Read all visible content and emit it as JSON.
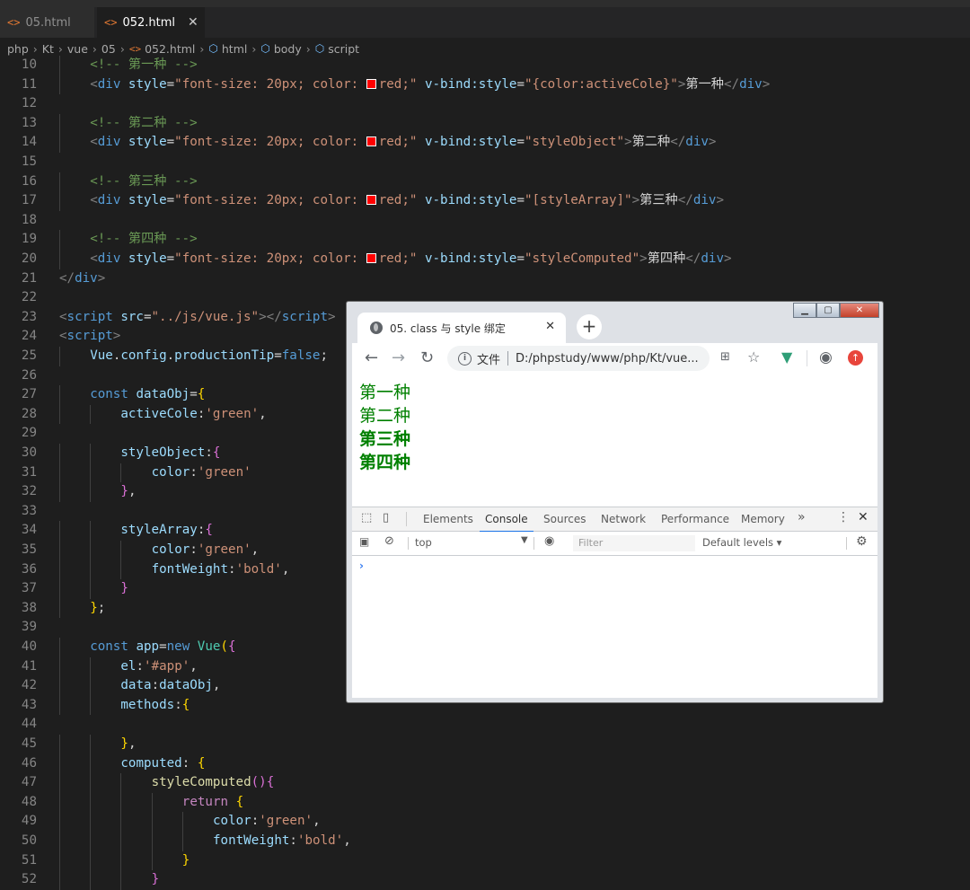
{
  "editor_tabs": [
    {
      "label": "05.html",
      "active": false
    },
    {
      "label": "052.html",
      "active": true
    }
  ],
  "breadcrumb": [
    "php",
    "Kt",
    "vue",
    "05",
    "052.html",
    "html",
    "body",
    "script"
  ],
  "code_lines": [
    {
      "n": "10",
      "indent": 1,
      "parts": [
        {
          "t": "<!-- 第一种 -->",
          "c": "cm"
        }
      ]
    },
    {
      "n": "11",
      "indent": 1,
      "parts": [
        {
          "t": "<",
          "c": "br"
        },
        {
          "t": "div",
          "c": "tag"
        },
        {
          "t": " style",
          "c": "at"
        },
        {
          "t": "=",
          "c": "tx"
        },
        {
          "t": "\"font-size: 20px; color: ",
          "c": "st"
        },
        {
          "t": "",
          "c": "swatch"
        },
        {
          "t": "red;\"",
          "c": "st"
        },
        {
          "t": " v-bind:style",
          "c": "at"
        },
        {
          "t": "=",
          "c": "tx"
        },
        {
          "t": "\"{color:activeCole}\"",
          "c": "st"
        },
        {
          "t": ">",
          "c": "br"
        },
        {
          "t": "第一种",
          "c": "tx"
        },
        {
          "t": "</",
          "c": "br"
        },
        {
          "t": "div",
          "c": "tag"
        },
        {
          "t": ">",
          "c": "br"
        }
      ]
    },
    {
      "n": "12",
      "indent": 0,
      "parts": []
    },
    {
      "n": "13",
      "indent": 1,
      "parts": [
        {
          "t": "<!-- 第二种 -->",
          "c": "cm"
        }
      ]
    },
    {
      "n": "14",
      "indent": 1,
      "parts": [
        {
          "t": "<",
          "c": "br"
        },
        {
          "t": "div",
          "c": "tag"
        },
        {
          "t": " style",
          "c": "at"
        },
        {
          "t": "=",
          "c": "tx"
        },
        {
          "t": "\"font-size: 20px; color: ",
          "c": "st"
        },
        {
          "t": "",
          "c": "swatch"
        },
        {
          "t": "red;\"",
          "c": "st"
        },
        {
          "t": " v-bind:style",
          "c": "at"
        },
        {
          "t": "=",
          "c": "tx"
        },
        {
          "t": "\"styleObject\"",
          "c": "st"
        },
        {
          "t": ">",
          "c": "br"
        },
        {
          "t": "第二种",
          "c": "tx"
        },
        {
          "t": "</",
          "c": "br"
        },
        {
          "t": "div",
          "c": "tag"
        },
        {
          "t": ">",
          "c": "br"
        }
      ]
    },
    {
      "n": "15",
      "indent": 0,
      "parts": []
    },
    {
      "n": "16",
      "indent": 1,
      "parts": [
        {
          "t": "<!-- 第三种 -->",
          "c": "cm"
        }
      ]
    },
    {
      "n": "17",
      "indent": 1,
      "parts": [
        {
          "t": "<",
          "c": "br"
        },
        {
          "t": "div",
          "c": "tag"
        },
        {
          "t": " style",
          "c": "at"
        },
        {
          "t": "=",
          "c": "tx"
        },
        {
          "t": "\"font-size: 20px; color: ",
          "c": "st"
        },
        {
          "t": "",
          "c": "swatch"
        },
        {
          "t": "red;\"",
          "c": "st"
        },
        {
          "t": " v-bind:style",
          "c": "at"
        },
        {
          "t": "=",
          "c": "tx"
        },
        {
          "t": "\"[styleArray]\"",
          "c": "st"
        },
        {
          "t": ">",
          "c": "br"
        },
        {
          "t": "第三种",
          "c": "tx"
        },
        {
          "t": "</",
          "c": "br"
        },
        {
          "t": "div",
          "c": "tag"
        },
        {
          "t": ">",
          "c": "br"
        }
      ]
    },
    {
      "n": "18",
      "indent": 0,
      "parts": []
    },
    {
      "n": "19",
      "indent": 1,
      "parts": [
        {
          "t": "<!-- 第四种 -->",
          "c": "cm"
        }
      ]
    },
    {
      "n": "20",
      "indent": 1,
      "parts": [
        {
          "t": "<",
          "c": "br"
        },
        {
          "t": "div",
          "c": "tag"
        },
        {
          "t": " style",
          "c": "at"
        },
        {
          "t": "=",
          "c": "tx"
        },
        {
          "t": "\"font-size: 20px; color: ",
          "c": "st"
        },
        {
          "t": "",
          "c": "swatch"
        },
        {
          "t": "red;\"",
          "c": "st"
        },
        {
          "t": " v-bind:style",
          "c": "at"
        },
        {
          "t": "=",
          "c": "tx"
        },
        {
          "t": "\"styleComputed\"",
          "c": "st"
        },
        {
          "t": ">",
          "c": "br"
        },
        {
          "t": "第四种",
          "c": "tx"
        },
        {
          "t": "</",
          "c": "br"
        },
        {
          "t": "div",
          "c": "tag"
        },
        {
          "t": ">",
          "c": "br"
        }
      ]
    },
    {
      "n": "21",
      "indent": 0,
      "parts": [
        {
          "t": "</",
          "c": "br"
        },
        {
          "t": "div",
          "c": "tag"
        },
        {
          "t": ">",
          "c": "br"
        }
      ]
    },
    {
      "n": "22",
      "indent": 0,
      "parts": []
    },
    {
      "n": "23",
      "indent": 0,
      "parts": [
        {
          "t": "<",
          "c": "br"
        },
        {
          "t": "script",
          "c": "tag"
        },
        {
          "t": " src",
          "c": "at"
        },
        {
          "t": "=",
          "c": "tx"
        },
        {
          "t": "\"../js/vue.js\"",
          "c": "st"
        },
        {
          "t": "></",
          "c": "br"
        },
        {
          "t": "script",
          "c": "tag"
        },
        {
          "t": ">",
          "c": "br"
        }
      ]
    },
    {
      "n": "24",
      "indent": 0,
      "parts": [
        {
          "t": "<",
          "c": "br"
        },
        {
          "t": "script",
          "c": "tag"
        },
        {
          "t": ">",
          "c": "br"
        }
      ]
    },
    {
      "n": "25",
      "indent": 1,
      "parts": [
        {
          "t": "Vue",
          "c": "at"
        },
        {
          "t": ".",
          "c": "tx"
        },
        {
          "t": "config",
          "c": "at"
        },
        {
          "t": ".",
          "c": "tx"
        },
        {
          "t": "productionTip",
          "c": "at"
        },
        {
          "t": "=",
          "c": "tx"
        },
        {
          "t": "false",
          "c": "kw"
        },
        {
          "t": ";",
          "c": "tx"
        }
      ]
    },
    {
      "n": "26",
      "indent": 0,
      "parts": []
    },
    {
      "n": "27",
      "indent": 1,
      "parts": [
        {
          "t": "const ",
          "c": "kw"
        },
        {
          "t": "dataObj",
          "c": "at"
        },
        {
          "t": "=",
          "c": "tx"
        },
        {
          "t": "{",
          "c": "y"
        }
      ]
    },
    {
      "n": "28",
      "indent": 2,
      "parts": [
        {
          "t": "activeCole",
          "c": "at"
        },
        {
          "t": ":",
          "c": "tx"
        },
        {
          "t": "'green'",
          "c": "st"
        },
        {
          "t": ",",
          "c": "tx"
        }
      ]
    },
    {
      "n": "29",
      "indent": 0,
      "parts": []
    },
    {
      "n": "30",
      "indent": 2,
      "parts": [
        {
          "t": "styleObject",
          "c": "at"
        },
        {
          "t": ":",
          "c": "tx"
        },
        {
          "t": "{",
          "c": "p"
        }
      ]
    },
    {
      "n": "31",
      "indent": 3,
      "parts": [
        {
          "t": "color",
          "c": "at"
        },
        {
          "t": ":",
          "c": "tx"
        },
        {
          "t": "'green'",
          "c": "st"
        }
      ]
    },
    {
      "n": "32",
      "indent": 2,
      "parts": [
        {
          "t": "}",
          "c": "p"
        },
        {
          "t": ",",
          "c": "tx"
        }
      ]
    },
    {
      "n": "33",
      "indent": 0,
      "parts": []
    },
    {
      "n": "34",
      "indent": 2,
      "parts": [
        {
          "t": "styleArray",
          "c": "at"
        },
        {
          "t": ":",
          "c": "tx"
        },
        {
          "t": "{",
          "c": "p"
        }
      ]
    },
    {
      "n": "35",
      "indent": 3,
      "parts": [
        {
          "t": "color",
          "c": "at"
        },
        {
          "t": ":",
          "c": "tx"
        },
        {
          "t": "'green'",
          "c": "st"
        },
        {
          "t": ",",
          "c": "tx"
        }
      ]
    },
    {
      "n": "36",
      "indent": 3,
      "parts": [
        {
          "t": "fontWeight",
          "c": "at"
        },
        {
          "t": ":",
          "c": "tx"
        },
        {
          "t": "'bold'",
          "c": "st"
        },
        {
          "t": ",",
          "c": "tx"
        }
      ]
    },
    {
      "n": "37",
      "indent": 2,
      "parts": [
        {
          "t": "}",
          "c": "p"
        }
      ]
    },
    {
      "n": "38",
      "indent": 1,
      "parts": [
        {
          "t": "}",
          "c": "y"
        },
        {
          "t": ";",
          "c": "tx"
        }
      ]
    },
    {
      "n": "39",
      "indent": 0,
      "parts": []
    },
    {
      "n": "40",
      "indent": 1,
      "parts": [
        {
          "t": "const ",
          "c": "kw"
        },
        {
          "t": "app",
          "c": "at"
        },
        {
          "t": "=",
          "c": "tx"
        },
        {
          "t": "new ",
          "c": "kw"
        },
        {
          "t": "Vue",
          "c": "cl"
        },
        {
          "t": "(",
          "c": "y"
        },
        {
          "t": "{",
          "c": "p"
        }
      ]
    },
    {
      "n": "41",
      "indent": 2,
      "parts": [
        {
          "t": "el",
          "c": "at"
        },
        {
          "t": ":",
          "c": "tx"
        },
        {
          "t": "'#app'",
          "c": "st"
        },
        {
          "t": ",",
          "c": "tx"
        }
      ]
    },
    {
      "n": "42",
      "indent": 2,
      "parts": [
        {
          "t": "data",
          "c": "at"
        },
        {
          "t": ":",
          "c": "tx"
        },
        {
          "t": "dataObj",
          "c": "at"
        },
        {
          "t": ",",
          "c": "tx"
        }
      ]
    },
    {
      "n": "43",
      "indent": 2,
      "parts": [
        {
          "t": "methods",
          "c": "at"
        },
        {
          "t": ":",
          "c": "tx"
        },
        {
          "t": "{",
          "c": "y"
        }
      ]
    },
    {
      "n": "44",
      "indent": 0,
      "parts": []
    },
    {
      "n": "45",
      "indent": 2,
      "parts": [
        {
          "t": "}",
          "c": "y"
        },
        {
          "t": ",",
          "c": "tx"
        }
      ]
    },
    {
      "n": "46",
      "indent": 2,
      "parts": [
        {
          "t": "computed",
          "c": "at"
        },
        {
          "t": ": ",
          "c": "tx"
        },
        {
          "t": "{",
          "c": "y"
        }
      ]
    },
    {
      "n": "47",
      "indent": 3,
      "parts": [
        {
          "t": "styleComputed",
          "c": "fn"
        },
        {
          "t": "()",
          "c": "p"
        },
        {
          "t": "{",
          "c": "p"
        }
      ]
    },
    {
      "n": "48",
      "indent": 4,
      "parts": [
        {
          "t": "return ",
          "c": "kw2"
        },
        {
          "t": "{",
          "c": "y"
        }
      ]
    },
    {
      "n": "49",
      "indent": 5,
      "parts": [
        {
          "t": "color",
          "c": "at"
        },
        {
          "t": ":",
          "c": "tx"
        },
        {
          "t": "'green'",
          "c": "st"
        },
        {
          "t": ",",
          "c": "tx"
        }
      ]
    },
    {
      "n": "50",
      "indent": 5,
      "parts": [
        {
          "t": "fontWeight",
          "c": "at"
        },
        {
          "t": ":",
          "c": "tx"
        },
        {
          "t": "'bold'",
          "c": "st"
        },
        {
          "t": ",",
          "c": "tx"
        }
      ]
    },
    {
      "n": "51",
      "indent": 4,
      "parts": [
        {
          "t": "}",
          "c": "y"
        }
      ]
    },
    {
      "n": "52",
      "indent": 3,
      "parts": [
        {
          "t": "}",
          "c": "p"
        }
      ]
    }
  ],
  "browser": {
    "tab_title": "05. class 与 style 绑定",
    "address_label": "文件",
    "address_url": "D:/phpstudy/www/php/Kt/vue...",
    "page_lines": [
      {
        "text": "第一种",
        "bold": false
      },
      {
        "text": "第二种",
        "bold": false
      },
      {
        "text": "第三种",
        "bold": true
      },
      {
        "text": "第四种",
        "bold": true
      }
    ],
    "page_text_color": "#008000",
    "devtools": {
      "tabs": [
        "Elements",
        "Console",
        "Sources",
        "Network",
        "Performance",
        "Memory"
      ],
      "active_tab": "Console",
      "context": "top",
      "filter_placeholder": "Filter",
      "levels": "Default levels ▾",
      "prompt": "›"
    }
  },
  "colors": {
    "editor_bg": "#1e1e1e",
    "swatch_red": "#ff0000",
    "devtools_accent": "#1a73e8"
  }
}
